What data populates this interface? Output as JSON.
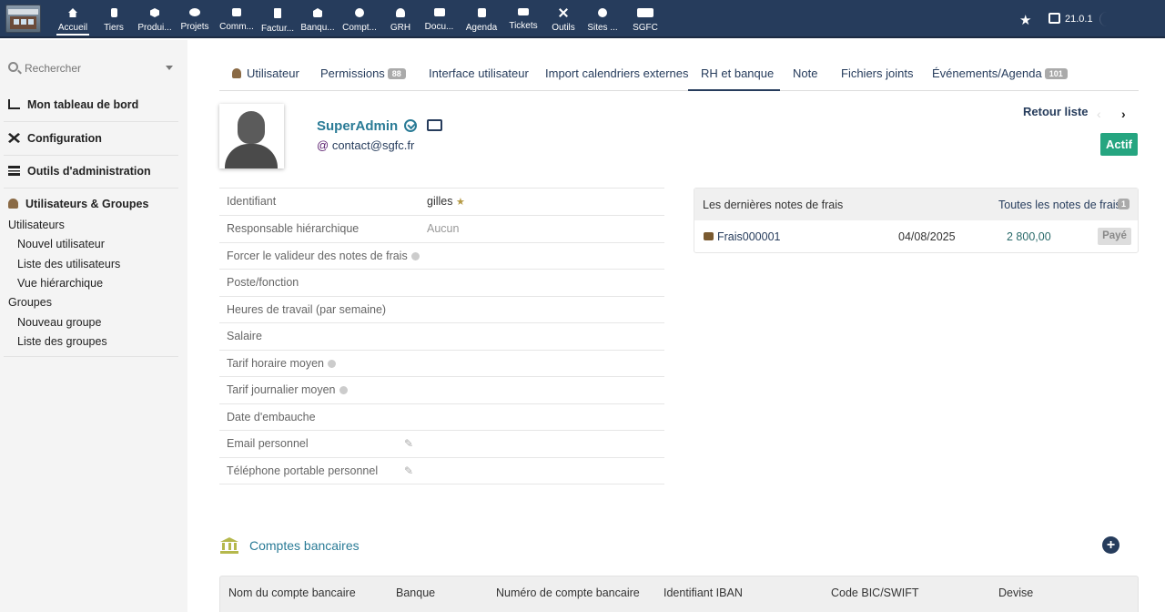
{
  "topbar": {
    "menu": [
      {
        "label": "Accueil",
        "icon": "home-icon"
      },
      {
        "label": "Tiers",
        "icon": "building-icon"
      },
      {
        "label": "Produi...",
        "icon": "cube-icon"
      },
      {
        "label": "Projets",
        "icon": "project-icon"
      },
      {
        "label": "Comm...",
        "icon": "briefcase-icon"
      },
      {
        "label": "Factur...",
        "icon": "invoice-icon"
      },
      {
        "label": "Banqu...",
        "icon": "bank-icon"
      },
      {
        "label": "Compt...",
        "icon": "search-dollar-icon"
      },
      {
        "label": "GRH",
        "icon": "user-icon"
      },
      {
        "label": "Docu...",
        "icon": "folder-icon"
      },
      {
        "label": "Agenda",
        "icon": "calendar-icon"
      },
      {
        "label": "Tickets",
        "icon": "ticket-icon"
      },
      {
        "label": "Outils",
        "icon": "tools-icon"
      },
      {
        "label": "Sites ...",
        "icon": "globe-icon"
      },
      {
        "label": "SGFC",
        "icon": "module-icon"
      }
    ],
    "version": "21.0.1"
  },
  "sidebar": {
    "search_placeholder": "Rechercher",
    "sections": [
      {
        "label": "Mon tableau de bord",
        "icon": "chart-icon"
      },
      {
        "label": "Configuration",
        "icon": "tools-icon"
      },
      {
        "label": "Outils d'administration",
        "icon": "server-icon"
      },
      {
        "label": "Utilisateurs & Groupes",
        "icon": "user-icon"
      }
    ],
    "sub": {
      "users": "Utilisateurs",
      "new_user": "Nouvel utilisateur",
      "user_list": "Liste des utilisateurs",
      "hierarchy": "Vue hiérarchique",
      "groups": "Groupes",
      "new_group": "Nouveau groupe",
      "group_list": "Liste des groupes"
    }
  },
  "tabs": [
    {
      "label": "Utilisateur",
      "badge": ""
    },
    {
      "label": "Permissions",
      "badge": "88"
    },
    {
      "label": "Interface utilisateur",
      "badge": ""
    },
    {
      "label": "Import calendriers externes",
      "badge": ""
    },
    {
      "label": "RH et banque",
      "badge": "",
      "active": true
    },
    {
      "label": "Note",
      "badge": ""
    },
    {
      "label": "Fichiers joints",
      "badge": ""
    },
    {
      "label": "Événements/Agenda",
      "badge": "101"
    }
  ],
  "profile": {
    "name": "SuperAdmin",
    "email_prefix": "@",
    "email": "contact@sgfc.fr",
    "back_list": "Retour liste",
    "status": "Actif",
    "status_color": "#25a580"
  },
  "fields": [
    {
      "label": "Identifiant",
      "value": "gilles",
      "star": "★"
    },
    {
      "label": "Responsable hiérarchique",
      "value": "Aucun"
    },
    {
      "label": "Forcer le valideur des notes de frais",
      "value": "",
      "info": true
    },
    {
      "label": "Poste/fonction",
      "value": ""
    },
    {
      "label": "Heures de travail (par semaine)",
      "value": ""
    },
    {
      "label": "Salaire",
      "value": ""
    },
    {
      "label": "Tarif horaire moyen",
      "value": "",
      "info": true
    },
    {
      "label": "Tarif journalier moyen",
      "value": "",
      "info": true
    },
    {
      "label": "Date d'embauche",
      "value": ""
    },
    {
      "label": "Email personnel",
      "value": "",
      "edit": true
    },
    {
      "label": "Téléphone portable personnel",
      "value": "",
      "edit": true
    }
  ],
  "expenses": {
    "title": "Les dernières notes de frais",
    "all_link": "Toutes les notes de frais",
    "count": "1",
    "rows": [
      {
        "ref": "Frais000001",
        "date": "04/08/2025",
        "amount": "2 800,00",
        "status": "Payé"
      }
    ]
  },
  "bank": {
    "title": "Comptes bancaires",
    "columns": [
      "Nom du compte bancaire",
      "Banque",
      "Numéro de compte bancaire",
      "Identifiant IBAN",
      "Code BIC/SWIFT",
      "Devise"
    ]
  }
}
